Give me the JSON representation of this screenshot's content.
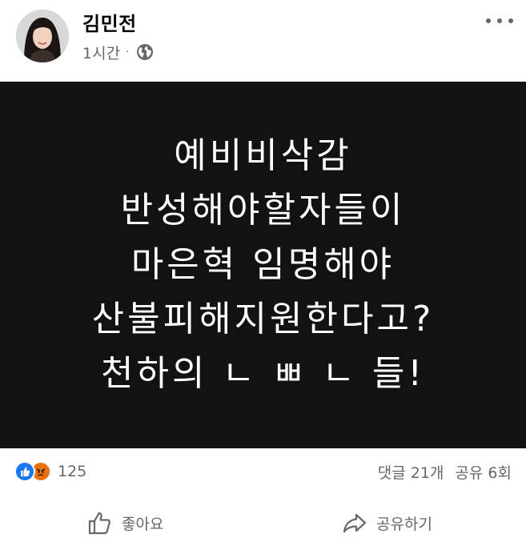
{
  "post": {
    "author": "김민전",
    "time": "1시간",
    "separator": "·",
    "privacy_icon": "globe-icon",
    "menu_icon": "more-horizontal-icon"
  },
  "image_text": {
    "line1": "예비비삭감",
    "line2": "반성해야할자들이",
    "line3": "마은혁 임명해야",
    "line4": "산불피해지원한다고?",
    "line5": "천하의 ㄴ ㅃ ㄴ 들!"
  },
  "stats": {
    "reaction_icons": [
      "like-icon",
      "angry-icon"
    ],
    "reaction_count": "125",
    "comments": "댓글 21개",
    "shares": "공유 6회"
  },
  "actions": {
    "like_label": "좋아요",
    "share_label": "공유하기"
  },
  "colors": {
    "like_blue": "#1877f2",
    "angry_orange": "#e9710f",
    "secondary_text": "#65676b",
    "image_bg": "#121212"
  }
}
